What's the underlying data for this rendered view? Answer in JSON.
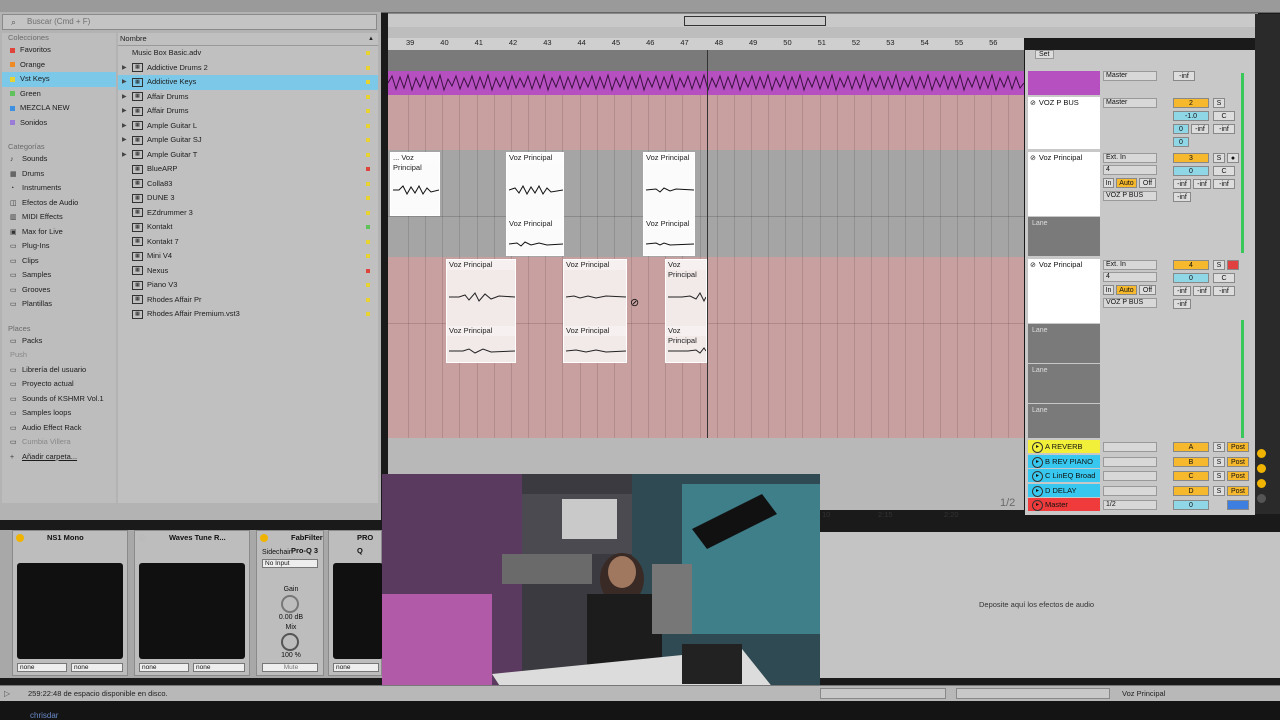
{
  "search": {
    "placeholder": "Buscar (Cmd + F)"
  },
  "collections": {
    "header": "Colecciones",
    "items": [
      {
        "label": "Favoritos",
        "color": "#e0433a"
      },
      {
        "label": "Orange",
        "color": "#f08a24"
      },
      {
        "label": "Vst Keys",
        "color": "#e8d230",
        "selected": true
      },
      {
        "label": "Green",
        "color": "#5fc25a"
      },
      {
        "label": "MEZCLA NEW",
        "color": "#3d8fe0"
      },
      {
        "label": "Sonidos",
        "color": "#9a7bd6"
      }
    ]
  },
  "categories": {
    "header": "Categorías",
    "items": [
      "Sounds",
      "Drums",
      "Instruments",
      "Efectos de Audio",
      "MIDI Effects",
      "Max for Live",
      "Plug-Ins",
      "Clips",
      "Samples",
      "Grooves",
      "Plantillas"
    ]
  },
  "places": {
    "header": "Places",
    "items": [
      "Packs",
      "Push",
      "Librería del usuario",
      "Proyecto actual",
      "Sounds of KSHMR Vol.1",
      "Samples loops",
      "Audio Effect Rack",
      "Cumbia Villera",
      "Añadir carpeta..."
    ]
  },
  "files": {
    "header": "Nombre",
    "items": [
      {
        "label": "Music Box Basic.adv"
      },
      {
        "label": "Addictive Drums 2"
      },
      {
        "label": "Addictive Keys",
        "selected": true
      },
      {
        "label": "Affair Drums"
      },
      {
        "label": "Affair Drums"
      },
      {
        "label": "Ample Guitar L"
      },
      {
        "label": "Ample Guitar SJ"
      },
      {
        "label": "Ample Guitar T"
      },
      {
        "label": "BlueARP"
      },
      {
        "label": "Colla83"
      },
      {
        "label": "DUNE 3"
      },
      {
        "label": "EZdrummer 3"
      },
      {
        "label": "Kontakt"
      },
      {
        "label": "Kontakt 7"
      },
      {
        "label": "Mini V4"
      },
      {
        "label": "Nexus"
      },
      {
        "label": "Piano V3"
      },
      {
        "label": "Rhodes Affair Pr"
      },
      {
        "label": "Rhodes Affair Premium.vst3"
      }
    ]
  },
  "ruler": {
    "bars": [
      "39",
      "40",
      "41",
      "42",
      "43",
      "44",
      "45",
      "46",
      "47",
      "48",
      "49",
      "50",
      "51",
      "52",
      "53",
      "54",
      "55",
      "56"
    ]
  },
  "clips": {
    "name": "Voz Principal",
    "name_truncated": "... Voz Principal"
  },
  "tracks": {
    "bus": {
      "name": "VOZ P BUS",
      "output": "Master",
      "number": "2",
      "volume": "-1.0",
      "pan": "C",
      "val0": "0",
      "inf": "-inf"
    },
    "track3": {
      "name": "Voz Principal",
      "input": "Ext. In",
      "channel": "4",
      "number": "3",
      "vol": "0",
      "pan": "C",
      "in": "In",
      "auto": "Auto",
      "off": "Off",
      "output": "VOZ P BUS",
      "lane": "Lane"
    },
    "track4": {
      "name": "Voz Principal",
      "input": "Ext. In",
      "channel": "4",
      "number": "4",
      "vol": "0",
      "pan": "C",
      "in": "In",
      "auto": "Auto",
      "off": "Off",
      "output": "VOZ P BUS",
      "lane": "Lane"
    },
    "top_output": "Master"
  },
  "returns": [
    {
      "label": "A REVERB",
      "color": "#f2ef3a",
      "letter": "A"
    },
    {
      "label": "B REV PIANO",
      "color": "#38c8ef",
      "letter": "B"
    },
    {
      "label": "C LinEQ Broad",
      "color": "#38c8ef",
      "letter": "C"
    },
    {
      "label": "D DELAY",
      "color": "#38c8ef",
      "letter": "D"
    },
    {
      "label": "Master",
      "color": "#ef3b3b",
      "letter": "0"
    }
  ],
  "mixer_misc": {
    "s": "S",
    "post": "Post",
    "half": "1/2",
    "page": "1/2"
  },
  "timeline2": {
    "t1": "2:15",
    "t2": "2:20",
    "t0": "10"
  },
  "devices": [
    {
      "title": "NS1 Mono",
      "sel_a": "none",
      "sel_b": "none"
    },
    {
      "title": "Waves Tune R...",
      "sel_a": "none",
      "sel_b": "none"
    },
    {
      "title": "FabFilter Pro-Q 3",
      "sidechain": "Sidechain",
      "input": "No Input",
      "gain_label": "Gain",
      "gain": "0.00 dB",
      "mix_label": "Mix",
      "mix": "100 %",
      "mute": "Mute"
    },
    {
      "title": "PRO Q",
      "sel_a": "none"
    }
  ],
  "dropzone": {
    "text": "Deposite aquí los efectos de audio"
  },
  "status": {
    "text": "259:22:48 de espacio disponible en disco.",
    "right": "Voz Principal"
  },
  "taskbar": {
    "left": "chrisdar"
  }
}
